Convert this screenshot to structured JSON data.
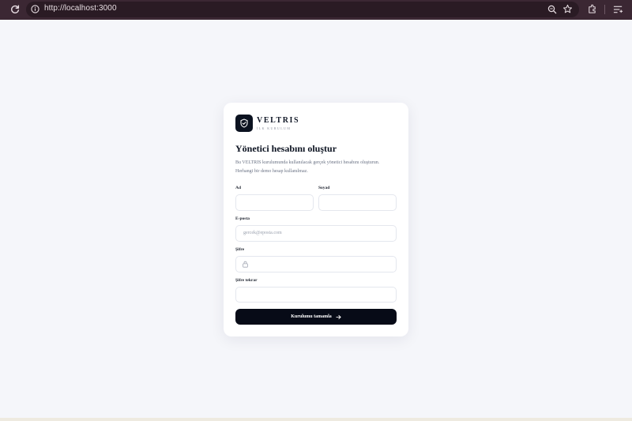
{
  "browser": {
    "url": "http://localhost:3000"
  },
  "brand": {
    "name": "VELTRIS",
    "subtitle": "İLK KURULUM"
  },
  "form": {
    "title": "Yönetici hesabını oluştur",
    "description": "Bu VELTRIS kurulumunda kullanılacak gerçek yönetici hesabını oluşturun. Herhangi bir demo hesap kullanılmaz.",
    "first_name_label": "Ad",
    "last_name_label": "Soyad",
    "email_label": "E-posta",
    "email_placeholder": "gercek@eposta.com",
    "password_label": "Şifre",
    "password_repeat_label": "Şifre tekrar",
    "submit_label": "Kurulumu tamamla"
  },
  "colors": {
    "background": "#f5f6fa",
    "chrome": "#3b2733",
    "primary": "#070b17"
  }
}
